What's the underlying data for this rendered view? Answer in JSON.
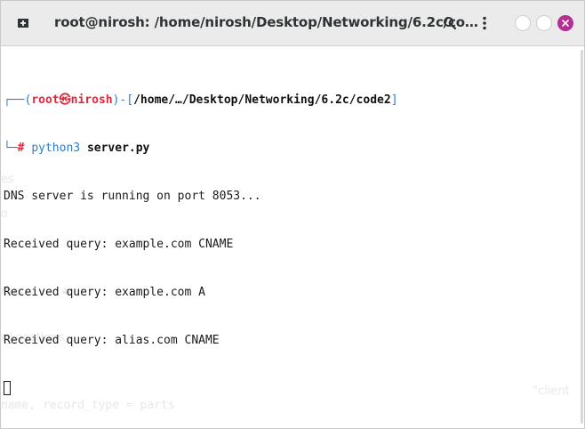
{
  "window": {
    "title": "root@nirosh: /home/nirosh/Desktop/Networking/6.2c/co…",
    "icons": {
      "new_tab": "new-tab-icon",
      "search": "search-icon",
      "menu": "kebab-menu-icon",
      "minimize": "minimize-icon",
      "maximize": "maximize-icon",
      "close": "close-icon"
    },
    "colors": {
      "close_button": "#b32f93",
      "prompt_blue": "#2e7bd1",
      "prompt_red": "#e0263a"
    }
  },
  "terminal": {
    "prompt": {
      "corner_top": "┌──(",
      "user": "root",
      "at_symbol": "㉿",
      "host": "nirosh",
      "sep_open": ")-[",
      "path": "/home/…/Desktop/Networking/6.2c/code2",
      "sep_close": "]",
      "corner_bottom": "└─",
      "hash": "#",
      "command": "python3",
      "argument": "server.py"
    },
    "output": [
      "DNS server is running on port 8053...",
      "Received query: example.com CNAME",
      "Received query: example.com A",
      "Received query: alias.com CNAME"
    ]
  },
  "ghost_text": {
    "g1": "es",
    "g2": "o",
    "g3": "rlus …",
    "g4": "r Locations",
    "g5": "\"client",
    "g6": "name, record_type = parts"
  }
}
